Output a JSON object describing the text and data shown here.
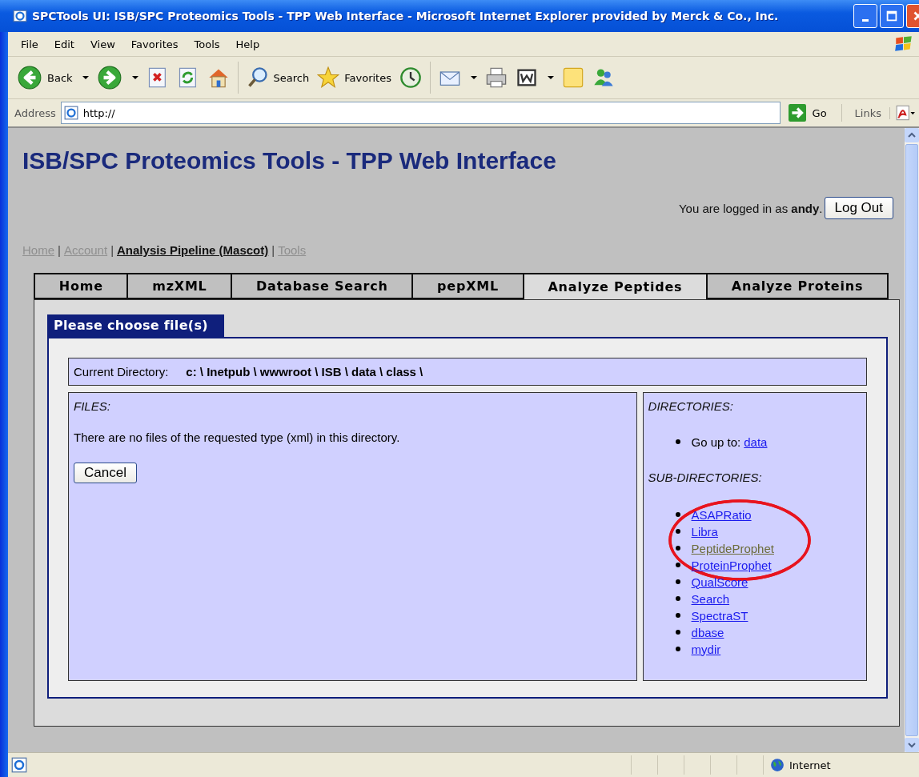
{
  "window": {
    "title": "SPCTools UI: ISB/SPC Proteomics Tools - TPP Web Interface - Microsoft Internet Explorer provided by Merck & Co., Inc."
  },
  "menu_bar": [
    {
      "label": "File"
    },
    {
      "label": "Edit"
    },
    {
      "label": "View"
    },
    {
      "label": "Favorites"
    },
    {
      "label": "Tools"
    },
    {
      "label": "Help"
    }
  ],
  "toolbar": [
    {
      "kind": "back",
      "label": "Back",
      "dropdown": true
    },
    {
      "kind": "forward",
      "dropdown": true
    },
    {
      "kind": "stop"
    },
    {
      "kind": "refresh"
    },
    {
      "kind": "home"
    },
    {
      "kind": "search",
      "label": "Search"
    },
    {
      "kind": "favorites",
      "label": "Favorites"
    },
    {
      "kind": "history"
    },
    {
      "kind": "mail",
      "dropdown": true
    },
    {
      "kind": "print"
    },
    {
      "kind": "word",
      "dropdown": true
    },
    {
      "kind": "note"
    },
    {
      "kind": "messenger"
    }
  ],
  "address_bar": {
    "label": "Address",
    "value": "http://",
    "go_label": "Go",
    "links_label": "Links"
  },
  "page": {
    "heading": "ISB/SPC Proteomics Tools - TPP Web Interface",
    "login_text": "You are logged in as **andy**.",
    "logout_button": "Log Out",
    "nav_separator": "|",
    "nav_links": [
      {
        "label": "Home",
        "selected": false
      },
      {
        "label": "Account",
        "selected": false
      },
      {
        "label": "Analysis Pipeline (Mascot)",
        "selected": true
      },
      {
        "label": "Tools",
        "selected": false
      }
    ],
    "tabs": [
      {
        "label": "Home",
        "selected": false
      },
      {
        "label": "mzXML",
        "selected": false
      },
      {
        "label": "Database Search",
        "selected": false
      },
      {
        "label": "pepXML",
        "selected": false
      },
      {
        "label": "Analyze Peptides",
        "selected": true
      },
      {
        "label": "Analyze Proteins",
        "selected": false
      }
    ],
    "panel_title": "Please choose file(s)",
    "current_directory": {
      "label": "Current Directory:",
      "path": "c: \\ Inetpub \\ wwwroot \\ ISB \\ data \\ class \\"
    },
    "files": {
      "heading": "FILES:",
      "message": "There are no files of the requested type (xml) in this directory.",
      "cancel_button": "Cancel"
    },
    "directories": {
      "heading": "DIRECTORIES:",
      "go_up_label": "Go up to:",
      "go_up_link": "data",
      "subdirectories_heading": "SUB-DIRECTORIES:",
      "subdirectories": [
        {
          "label": "ASAPRatio",
          "visited": false
        },
        {
          "label": "Libra",
          "visited": false
        },
        {
          "label": "PeptideProphet",
          "visited": true
        },
        {
          "label": "ProteinProphet",
          "visited": false
        },
        {
          "label": "QualScore",
          "visited": false
        },
        {
          "label": "Search",
          "visited": false
        },
        {
          "label": "SpectraST",
          "visited": false
        },
        {
          "label": "dbase",
          "visited": false
        },
        {
          "label": "mydir",
          "visited": false
        }
      ]
    }
  },
  "status_bar": {
    "zone": "Internet"
  }
}
